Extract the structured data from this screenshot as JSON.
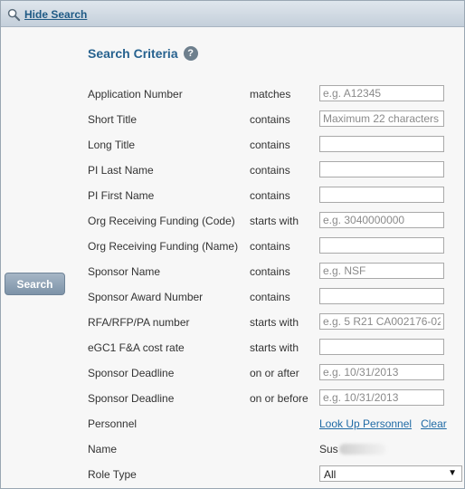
{
  "topbar": {
    "hide_search_label": "Hide Search"
  },
  "section": {
    "title": "Search Criteria",
    "help_glyph": "?"
  },
  "search_button": {
    "label": "Search"
  },
  "criteria": [
    {
      "label": "Application Number",
      "operator": "matches",
      "value": "",
      "placeholder": "e.g. A12345"
    },
    {
      "label": "Short Title",
      "operator": "contains",
      "value": "",
      "placeholder": "Maximum 22 characters"
    },
    {
      "label": "Long Title",
      "operator": "contains",
      "value": "",
      "placeholder": ""
    },
    {
      "label": "PI Last Name",
      "operator": "contains",
      "value": "",
      "placeholder": ""
    },
    {
      "label": "PI First Name",
      "operator": "contains",
      "value": "",
      "placeholder": ""
    },
    {
      "label": "Org Receiving Funding (Code)",
      "operator": "starts with",
      "value": "",
      "placeholder": "e.g. 3040000000"
    },
    {
      "label": "Org Receiving Funding (Name)",
      "operator": "contains",
      "value": "",
      "placeholder": ""
    },
    {
      "label": "Sponsor Name",
      "operator": "contains",
      "value": "",
      "placeholder": "e.g. NSF"
    },
    {
      "label": "Sponsor Award Number",
      "operator": "contains",
      "value": "",
      "placeholder": ""
    },
    {
      "label": "RFA/RFP/PA number",
      "operator": "starts with",
      "value": "",
      "placeholder": "e.g. 5 R21 CA002176-02"
    },
    {
      "label": "eGC1 F&A cost rate",
      "operator": "starts with",
      "value": "",
      "placeholder": ""
    },
    {
      "label": "Sponsor Deadline",
      "operator": "on or after",
      "value": "",
      "placeholder": "e.g. 10/31/2013"
    },
    {
      "label": "Sponsor Deadline",
      "operator": "on or before",
      "value": "",
      "placeholder": "e.g. 10/31/2013"
    }
  ],
  "personnel": {
    "label": "Personnel",
    "lookup_link": "Look Up Personnel",
    "clear_link": "Clear"
  },
  "name": {
    "label": "Name",
    "value_visible": "Sus"
  },
  "role_type": {
    "label": "Role Type",
    "selected": "All",
    "arrow": "▼"
  },
  "icons": {
    "hide_search": "magnifier-icon",
    "help": "help-icon",
    "select_arrow": "chevron-down-icon"
  },
  "colors": {
    "link": "#1f6aa5",
    "title": "#27628f",
    "button": "#7d93a8"
  }
}
